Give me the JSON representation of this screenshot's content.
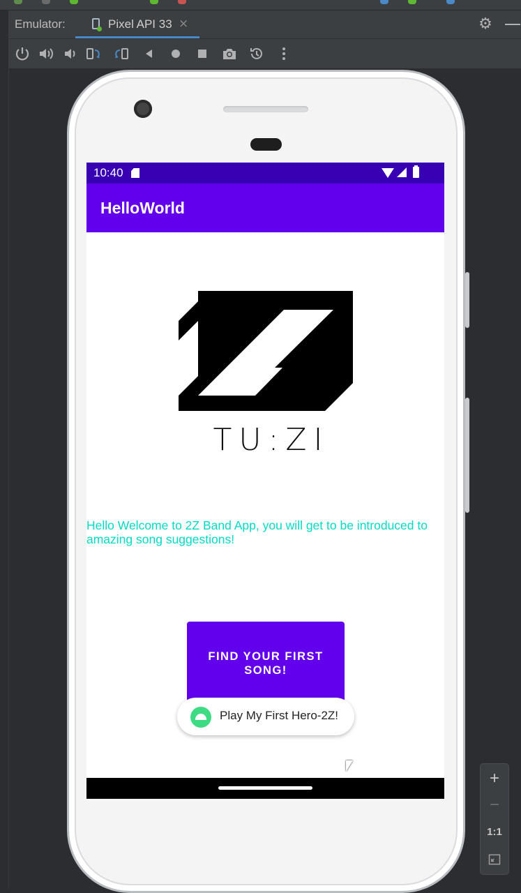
{
  "ide": {
    "tab_label": "Emulator:",
    "device_tab": "Pixel API 33",
    "tab_close": "×",
    "toolbar_icons": [
      "power-icon",
      "volume-up-icon",
      "volume-down-icon",
      "rotate-left-icon",
      "rotate-right-icon",
      "back-icon",
      "home-icon",
      "overview-icon",
      "screenshot-icon",
      "snapshot-icon",
      "more-icon"
    ]
  },
  "device": {
    "status_time": "10:40",
    "app_title": "HelloWorld",
    "logo_text": "TU:ZI",
    "welcome_text": "Hello Welcome to 2Z Band App, you will get to be introduced to amazing song suggestions!",
    "button_label": "FIND YOUR FIRST SONG!",
    "toast_text": "Play My First Hero-2Z!",
    "colors": {
      "status_bar": "#3700b3",
      "app_bar": "#6200ee",
      "accent_text": "#03dac5",
      "button": "#6200ee"
    }
  },
  "zoom": {
    "zoom_in": "+",
    "zoom_out": "−",
    "actual_size": "1:1"
  }
}
